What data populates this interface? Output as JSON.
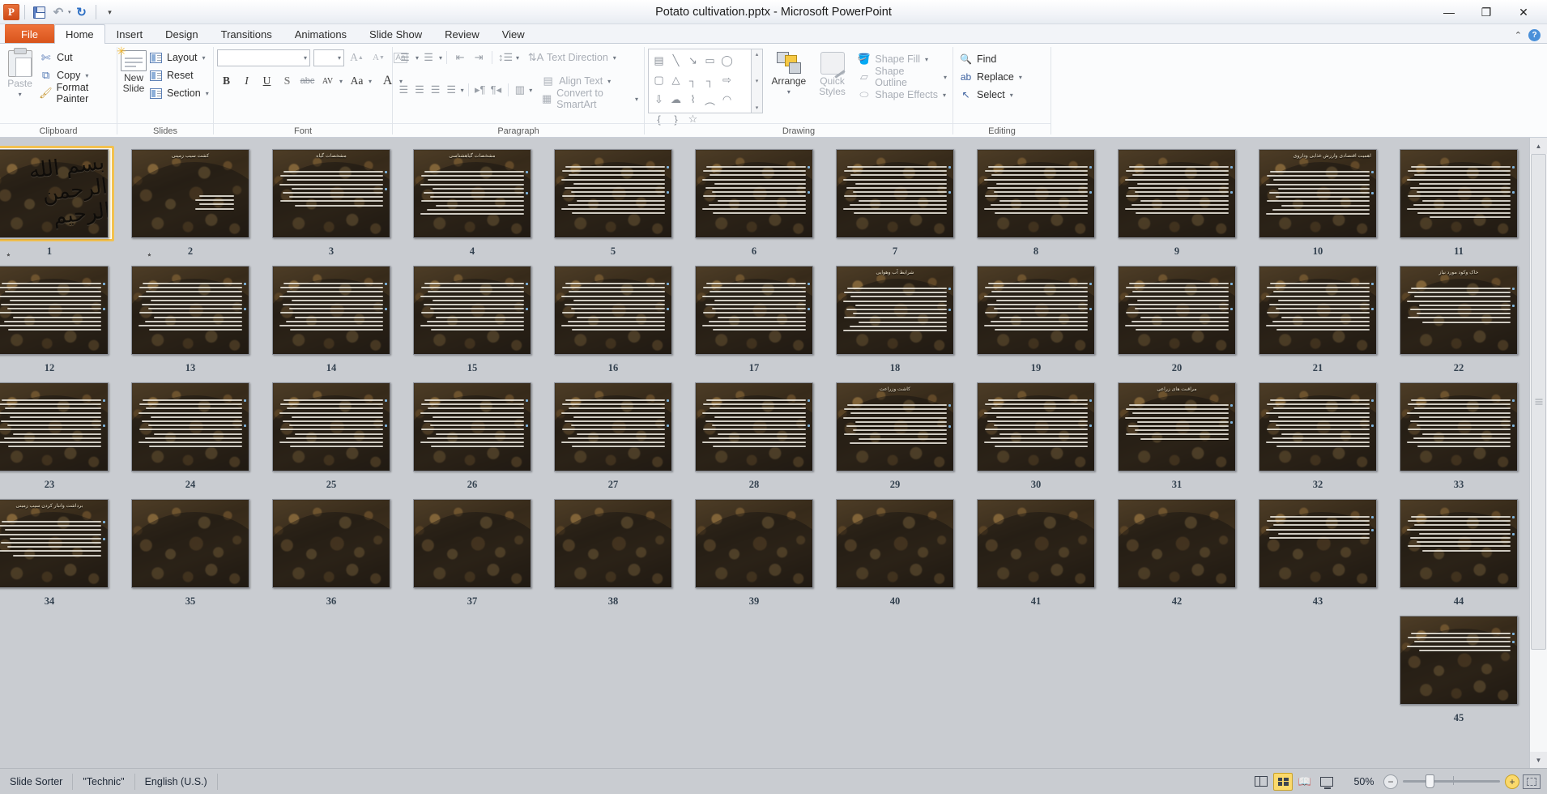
{
  "window": {
    "title": "Potato cultivation.pptx  -  Microsoft PowerPoint",
    "app_logo": "powerpoint-logo",
    "minimize": "—",
    "restore": "❐",
    "close": "✕"
  },
  "quick_access": {
    "save": "save-icon",
    "undo": "↶",
    "undo_caret": "▾",
    "redo": "↻",
    "customize": "▾"
  },
  "tabs": [
    {
      "label": "File",
      "id": "file"
    },
    {
      "label": "Home",
      "id": "home"
    },
    {
      "label": "Insert",
      "id": "insert"
    },
    {
      "label": "Design",
      "id": "design"
    },
    {
      "label": "Transitions",
      "id": "transitions"
    },
    {
      "label": "Animations",
      "id": "animations"
    },
    {
      "label": "Slide Show",
      "id": "slide-show"
    },
    {
      "label": "Review",
      "id": "review"
    },
    {
      "label": "View",
      "id": "view"
    }
  ],
  "tab_right": {
    "minimize_ribbon": "⌃",
    "help": "?"
  },
  "ribbon": {
    "clipboard": {
      "label": "Clipboard",
      "paste": "Paste",
      "paste_caret": "▾",
      "cut": "Cut",
      "copy": "Copy",
      "copy_caret": "▾",
      "format_painter": "Format Painter"
    },
    "slides": {
      "label": "Slides",
      "new_slide": "New",
      "new_slide2": "Slide",
      "new_slide_caret": "▾",
      "layout": "Layout",
      "layout_caret": "▾",
      "reset": "Reset",
      "section": "Section",
      "section_caret": "▾"
    },
    "font": {
      "label": "Font",
      "font_name_value": "",
      "font_name_placeholder": "",
      "font_size_value": "",
      "grow": "A",
      "shrink": "A",
      "clear_formatting": "Aa",
      "bold": "B",
      "italic": "I",
      "underline": "U",
      "shadow": "S",
      "strikethrough": "abc",
      "spacing": "AV",
      "change_case": "Aa",
      "font_color": "A"
    },
    "paragraph": {
      "label": "Paragraph",
      "text_direction": "Text Direction",
      "align_text": "Align Text",
      "convert_smartart": "Convert to SmartArt"
    },
    "drawing": {
      "label": "Drawing",
      "arrange": "Arrange",
      "arrange_caret": "▾",
      "quick_styles": "Quick",
      "quick_styles2": "Styles",
      "quick_styles_caret": "▾",
      "shape_fill": "Shape Fill",
      "shape_outline": "Shape Outline",
      "shape_effects": "Shape Effects",
      "shapes": [
        "textbox",
        "line",
        "arrow",
        "rectangle",
        "oval",
        "rounded-rect",
        "triangle",
        "elbow-connector",
        "elbow-arrow-connector",
        "right-arrow",
        "down-arrow",
        "cloud",
        "freeform",
        "curve",
        "arc",
        "left-brace",
        "right-brace",
        "star"
      ],
      "gallery_up": "▴",
      "gallery_down": "▾",
      "gallery_more": "▾"
    },
    "editing": {
      "label": "Editing",
      "find": "Find",
      "replace": "Replace",
      "replace_caret": "▾",
      "select": "Select",
      "select_caret": "▾"
    }
  },
  "sorter": {
    "selected_slide": 1,
    "rows": [
      [
        {
          "n": 11,
          "kind": "body",
          "title": "",
          "lines": 13,
          "transition": false
        },
        {
          "n": 10,
          "kind": "body",
          "title": "اهمیت اقتصادی وارزش غذایی وداروی",
          "lines": 11,
          "transition": false
        },
        {
          "n": 9,
          "kind": "body",
          "title": "",
          "lines": 12,
          "transition": false
        },
        {
          "n": 8,
          "kind": "body",
          "title": "",
          "lines": 12,
          "transition": false
        },
        {
          "n": 7,
          "kind": "body",
          "title": "",
          "lines": 12,
          "transition": false
        },
        {
          "n": 6,
          "kind": "body",
          "title": "",
          "lines": 12,
          "transition": false
        },
        {
          "n": 5,
          "kind": "body",
          "title": "",
          "lines": 12,
          "transition": false
        },
        {
          "n": 4,
          "kind": "body",
          "title": "مشخصات گیاهشناسی",
          "lines": 11,
          "transition": false
        },
        {
          "n": 3,
          "kind": "body",
          "title": "مشخصات گیاه",
          "lines": 9,
          "transition": false
        },
        {
          "n": 2,
          "kind": "title",
          "title": "کشت سیب زمینی",
          "lines": 4,
          "transition": true
        },
        {
          "n": 1,
          "kind": "cover",
          "title": "بسم الله الرحمن الرحیم",
          "lines": 0,
          "transition": true
        }
      ],
      [
        {
          "n": 22,
          "kind": "body",
          "title": "خاک وکود مورد نیاز",
          "lines": 9,
          "transition": false
        },
        {
          "n": 21,
          "kind": "body",
          "title": "",
          "lines": 12,
          "transition": false
        },
        {
          "n": 20,
          "kind": "body",
          "title": "",
          "lines": 12,
          "transition": false
        },
        {
          "n": 19,
          "kind": "body",
          "title": "",
          "lines": 12,
          "transition": false
        },
        {
          "n": 18,
          "kind": "body",
          "title": "شرایط آب وهوایی",
          "lines": 11,
          "transition": false
        },
        {
          "n": 17,
          "kind": "body",
          "title": "",
          "lines": 12,
          "transition": false
        },
        {
          "n": 16,
          "kind": "body",
          "title": "",
          "lines": 12,
          "transition": false
        },
        {
          "n": 15,
          "kind": "body",
          "title": "",
          "lines": 12,
          "transition": false
        },
        {
          "n": 14,
          "kind": "body",
          "title": "",
          "lines": 12,
          "transition": false
        },
        {
          "n": 13,
          "kind": "body",
          "title": "",
          "lines": 12,
          "transition": false
        },
        {
          "n": 12,
          "kind": "body",
          "title": "",
          "lines": 12,
          "transition": false
        }
      ],
      [
        {
          "n": 33,
          "kind": "body",
          "title": "",
          "lines": 12,
          "transition": false
        },
        {
          "n": 32,
          "kind": "body",
          "title": "",
          "lines": 12,
          "transition": false
        },
        {
          "n": 31,
          "kind": "body",
          "title": "مراقبت های زراعی",
          "lines": 9,
          "transition": false
        },
        {
          "n": 30,
          "kind": "body",
          "title": "",
          "lines": 12,
          "transition": false
        },
        {
          "n": 29,
          "kind": "body",
          "title": "کاشت وزراعت",
          "lines": 10,
          "transition": false
        },
        {
          "n": 28,
          "kind": "body",
          "title": "",
          "lines": 12,
          "transition": false
        },
        {
          "n": 27,
          "kind": "body",
          "title": "",
          "lines": 12,
          "transition": false
        },
        {
          "n": 26,
          "kind": "body",
          "title": "",
          "lines": 12,
          "transition": false
        },
        {
          "n": 25,
          "kind": "body",
          "title": "",
          "lines": 12,
          "transition": false
        },
        {
          "n": 24,
          "kind": "body",
          "title": "",
          "lines": 12,
          "transition": false
        },
        {
          "n": 23,
          "kind": "body",
          "title": "",
          "lines": 12,
          "transition": false
        }
      ],
      [
        {
          "n": 44,
          "kind": "body",
          "title": "",
          "lines": 9,
          "transition": false
        },
        {
          "n": 43,
          "kind": "body",
          "title": "",
          "lines": 6,
          "transition": false
        },
        {
          "n": 42,
          "kind": "blank",
          "title": "",
          "lines": 0,
          "transition": false
        },
        {
          "n": 41,
          "kind": "blank",
          "title": "",
          "lines": 0,
          "transition": false
        },
        {
          "n": 40,
          "kind": "blank",
          "title": "",
          "lines": 0,
          "transition": false
        },
        {
          "n": 39,
          "kind": "blank",
          "title": "",
          "lines": 0,
          "transition": false
        },
        {
          "n": 38,
          "kind": "blank",
          "title": "",
          "lines": 0,
          "transition": false
        },
        {
          "n": 37,
          "kind": "blank",
          "title": "",
          "lines": 0,
          "transition": false
        },
        {
          "n": 36,
          "kind": "blank",
          "title": "",
          "lines": 0,
          "transition": false
        },
        {
          "n": 35,
          "kind": "blank",
          "title": "",
          "lines": 0,
          "transition": false
        },
        {
          "n": 34,
          "kind": "body",
          "title": "برداشت وانبار کردن سیب زمینی",
          "lines": 9,
          "transition": false
        }
      ],
      [
        {
          "n": 45,
          "kind": "body",
          "title": "",
          "lines": 5,
          "transition": false
        }
      ]
    ]
  },
  "statusbar": {
    "view_name": "Slide Sorter",
    "theme": "\"Technic\"",
    "language": "English (U.S.)",
    "zoom_level": "50%",
    "zoom_out": "−",
    "zoom_in": "+",
    "view_buttons": [
      {
        "name": "normal-view",
        "active": false
      },
      {
        "name": "slide-sorter-view",
        "active": true
      },
      {
        "name": "reading-view",
        "active": false
      },
      {
        "name": "slide-show-view",
        "active": false
      }
    ],
    "fit_to_window": "fit-slide-to-window"
  }
}
